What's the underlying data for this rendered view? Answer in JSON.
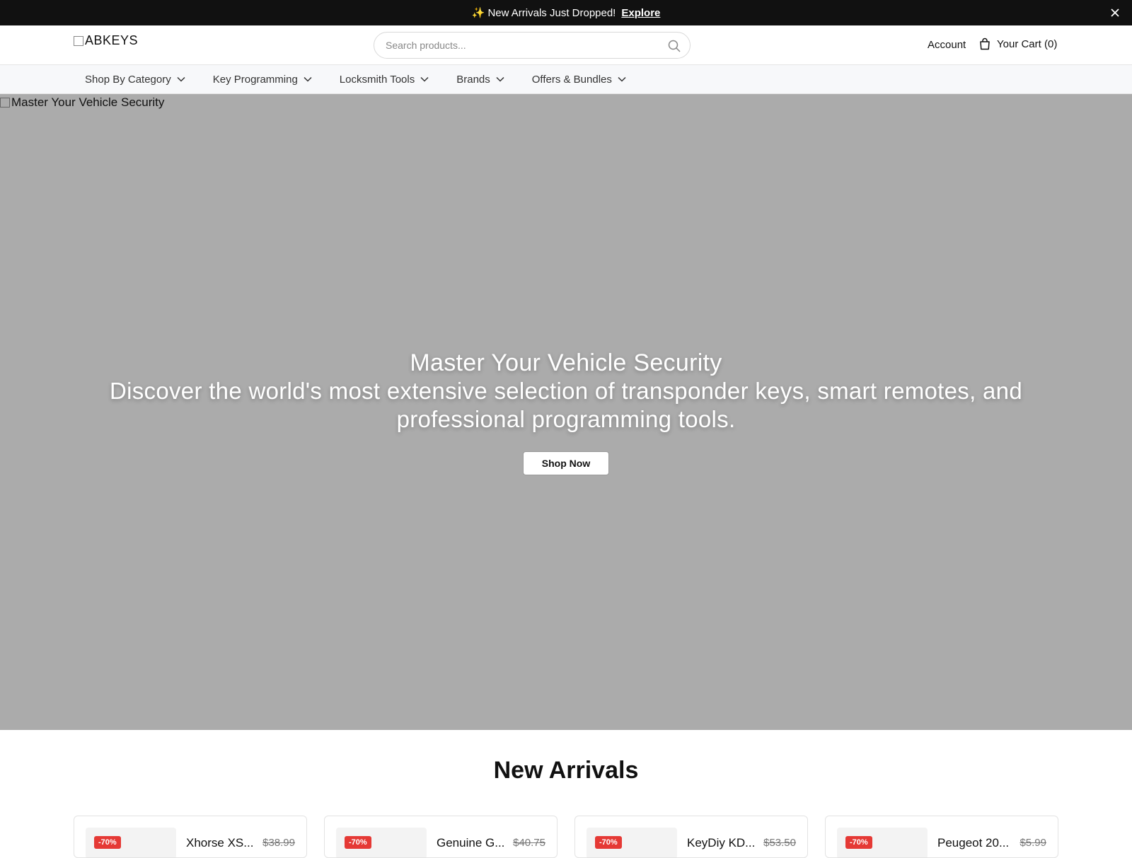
{
  "announcement": {
    "emoji": "✨",
    "message": "New Arrivals Just Dropped!",
    "link_label": "Explore",
    "close_label": "✕"
  },
  "header": {
    "logo_text": "ABKEYS",
    "search_placeholder": "Search products...",
    "account_label": "Account",
    "cart_label": "Your Cart (0)"
  },
  "nav": {
    "items": [
      {
        "label": "Shop By Category"
      },
      {
        "label": "Key Programming"
      },
      {
        "label": "Locksmith Tools"
      },
      {
        "label": "Brands"
      },
      {
        "label": "Offers & Bundles"
      }
    ]
  },
  "hero": {
    "image_alt": "Master Your Vehicle Security",
    "title": "Master Your Vehicle Security",
    "subtitle": "Discover the world's most extensive selection of transponder keys, smart remotes, and professional programming tools.",
    "cta_label": "Shop Now",
    "background_color": "#ababab"
  },
  "new_arrivals": {
    "title": "New Arrivals",
    "products": [
      {
        "name": "Xhorse XS...",
        "old_price": "$38.99",
        "badge": "-70%"
      },
      {
        "name": "Genuine G...",
        "old_price": "$40.75",
        "badge": "-70%"
      },
      {
        "name": "KeyDiy KD...",
        "old_price": "$53.50",
        "badge": "-70%"
      },
      {
        "name": "Peugeot 20...",
        "old_price": "$5.99",
        "badge": "-70%"
      }
    ]
  },
  "colors": {
    "announcement_bg": "#111111",
    "badge": "#e53935",
    "nav_bg": "#f7f8fa"
  }
}
